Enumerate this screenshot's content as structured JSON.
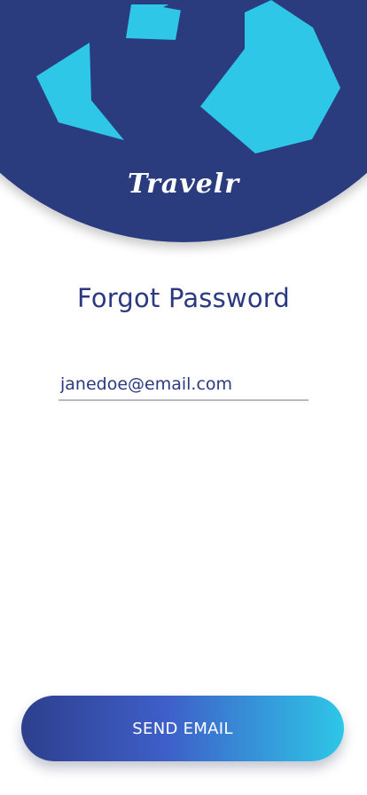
{
  "brand": {
    "name": "Travelr"
  },
  "page": {
    "title": "Forgot Password"
  },
  "form": {
    "email_value": "janedoe@email.com"
  },
  "actions": {
    "send_label": "SEND EMAIL"
  },
  "colors": {
    "globe": "#2c3b7e",
    "landmass": "#2ec7e7",
    "title": "#2b3a80",
    "button_gradient_start": "#2d3f8c",
    "button_gradient_mid": "#3e5fc9",
    "button_gradient_end": "#2ec7e7"
  },
  "icons": {
    "header_art": "globe-illustration"
  }
}
